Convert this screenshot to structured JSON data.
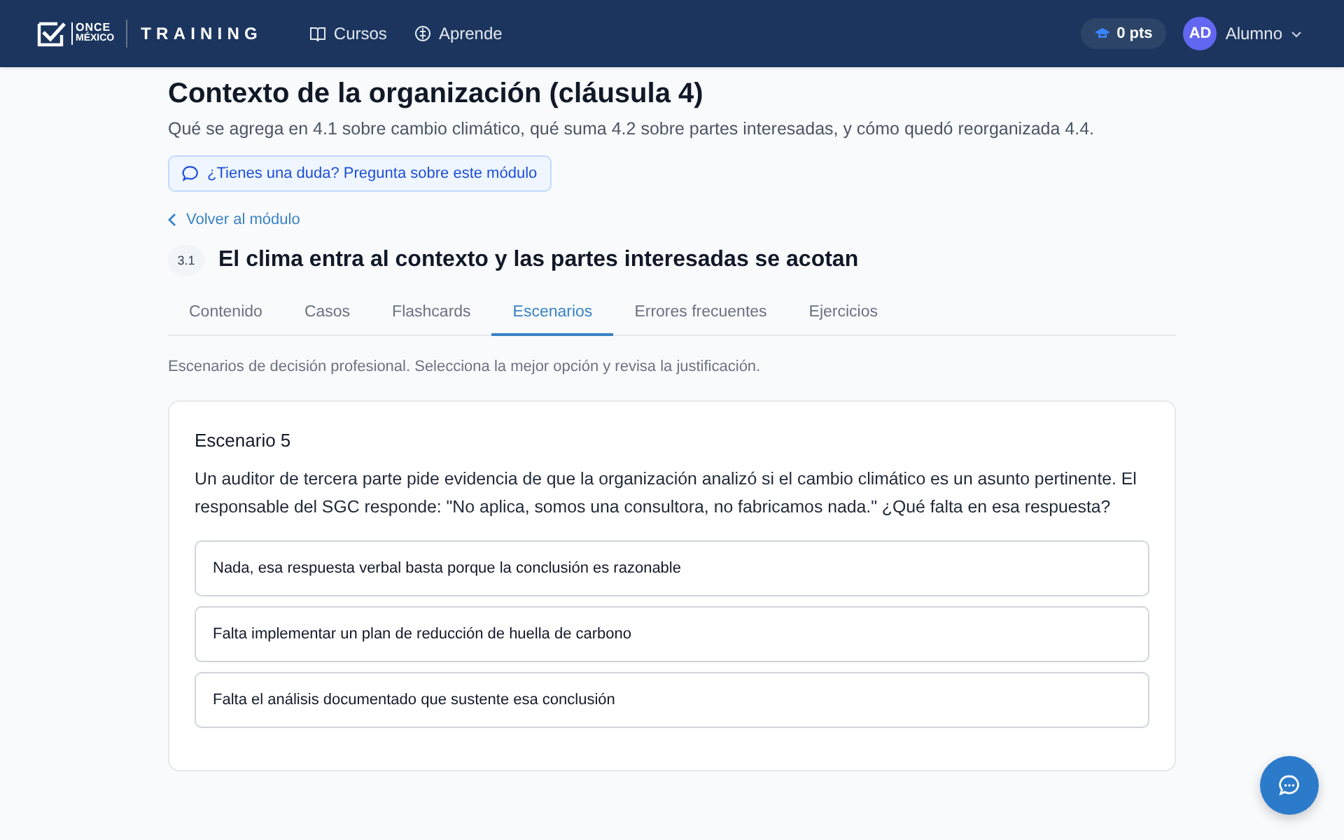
{
  "header": {
    "logo_top": "ONCE",
    "logo_bottom": "MÉXICO",
    "brand": "TRAINING",
    "nav": [
      {
        "label": "Cursos"
      },
      {
        "label": "Aprende"
      }
    ],
    "points": "0 pts",
    "user": {
      "initials": "AD",
      "name": "Alumno"
    }
  },
  "page": {
    "title": "Contexto de la organización (cláusula 4)",
    "subtitle": "Qué se agrega en 4.1 sobre cambio climático, qué suma 4.2 sobre partes interesadas, y cómo quedó reorganizada 4.4.",
    "ask_button": "¿Tienes una duda? Pregunta sobre este módulo",
    "back_link": "Volver al módulo",
    "section_number": "3.1",
    "section_title": "El clima entra al contexto y las partes interesadas se acotan"
  },
  "tabs": [
    {
      "label": "Contenido",
      "selected": false
    },
    {
      "label": "Casos",
      "selected": false
    },
    {
      "label": "Flashcards",
      "selected": false
    },
    {
      "label": "Escenarios",
      "selected": true
    },
    {
      "label": "Errores frecuentes",
      "selected": false
    },
    {
      "label": "Ejercicios",
      "selected": false
    }
  ],
  "intro": "Escenarios de decisión profesional. Selecciona la mejor opción y revisa la justificación.",
  "scenario": {
    "title": "Escenario 5",
    "question": "Un auditor de tercera parte pide evidencia de que la organización analizó si el cambio climático es un asunto pertinente. El responsable del SGC responde: \"No aplica, somos una consultora, no fabricamos nada.\" ¿Qué falta en esa respuesta?",
    "options": [
      "Nada, esa respuesta verbal basta porque la conclusión es razonable",
      "Falta implementar un plan de reducción de huella de carbono",
      "Falta el análisis documentado que sustente esa conclusión"
    ]
  }
}
